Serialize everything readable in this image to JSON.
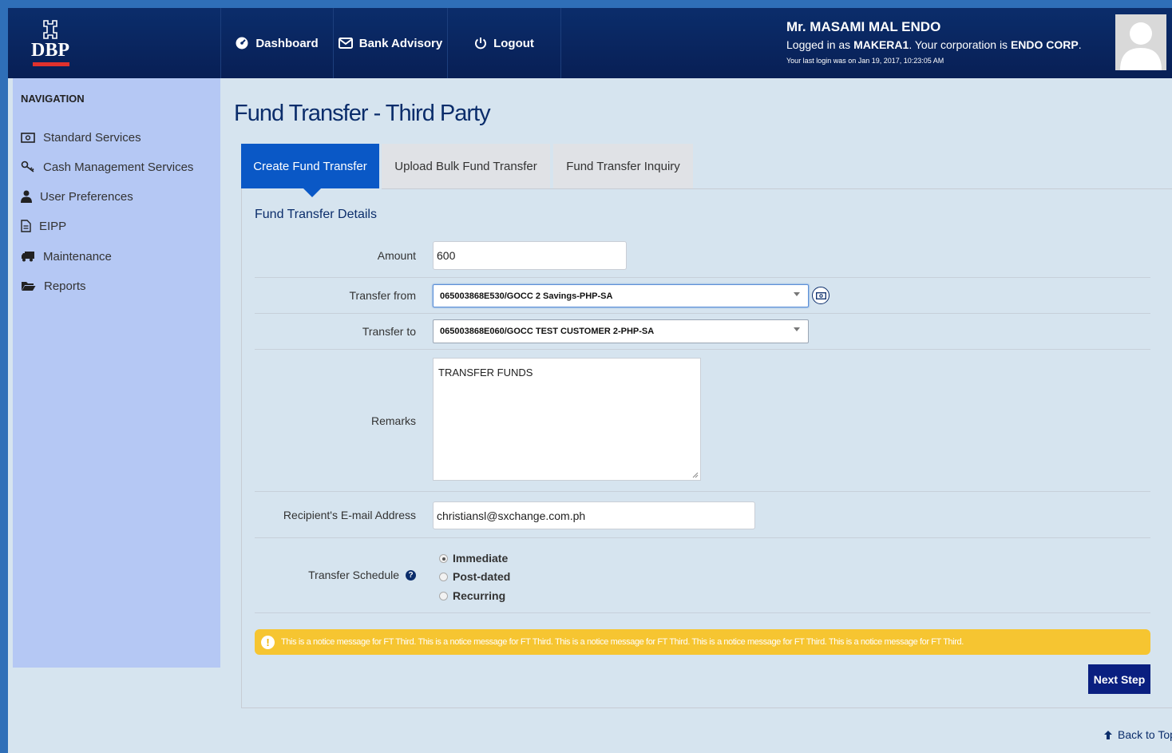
{
  "header": {
    "logo_text": "DBP",
    "nav": [
      {
        "label": "Dashboard",
        "icon": "dashboard-icon"
      },
      {
        "label": "Bank Advisory",
        "icon": "envelope-icon"
      },
      {
        "label": "Logout",
        "icon": "power-icon"
      }
    ],
    "user": {
      "name": "Mr. MASAMI MAL ENDO",
      "logged_prefix": "Logged in as",
      "username": "MAKERA1",
      "corp_prefix": ". Your corporation is",
      "corporation": "ENDO CORP",
      "corp_suffix": ".",
      "last_login": "Your last login was on Jan 19, 2017, 10:23:05 AM"
    }
  },
  "sidebar": {
    "title": "NAVIGATION",
    "items": [
      {
        "label": "Standard Services",
        "icon": "money-icon"
      },
      {
        "label": "Cash Management Services",
        "icon": "key-icon"
      },
      {
        "label": "User Preferences",
        "icon": "user-icon"
      },
      {
        "label": "EIPP",
        "icon": "document-icon"
      },
      {
        "label": "Maintenance",
        "icon": "truck-icon"
      },
      {
        "label": "Reports",
        "icon": "folder-icon"
      }
    ]
  },
  "main": {
    "title": "Fund Transfer - Third Party",
    "tabs": [
      {
        "label": "Create Fund Transfer",
        "active": true
      },
      {
        "label": "Upload Bulk Fund Transfer",
        "active": false
      },
      {
        "label": "Fund Transfer Inquiry",
        "active": false
      }
    ],
    "section_title": "Fund Transfer Details",
    "form": {
      "amount_label": "Amount",
      "amount_value": "600",
      "from_label": "Transfer from",
      "from_value": "065003868E530/GOCC 2 Savings-PHP-SA",
      "to_label": "Transfer to",
      "to_value": "065003868E060/GOCC TEST CUSTOMER 2-PHP-SA",
      "remarks_label": "Remarks",
      "remarks_value": "TRANSFER FUNDS",
      "email_label": "Recipient's E-mail Address",
      "email_value": "christiansl@sxchange.com.ph",
      "schedule_label": "Transfer Schedule",
      "schedule_options": [
        {
          "label": "Immediate",
          "selected": true
        },
        {
          "label": "Post-dated",
          "selected": false
        },
        {
          "label": "Recurring",
          "selected": false
        }
      ]
    },
    "notice": "This is a notice message for FT Third. This is a notice message for FT Third. This is a notice message for FT Third. This is a notice message for FT Third. This is a notice message for FT Third.",
    "next_button": "Next Step",
    "back_to_top": "Back to Top"
  },
  "colors": {
    "brand": "#0b2d6b",
    "accent": "#0a58c6",
    "notice": "#f6c531"
  }
}
